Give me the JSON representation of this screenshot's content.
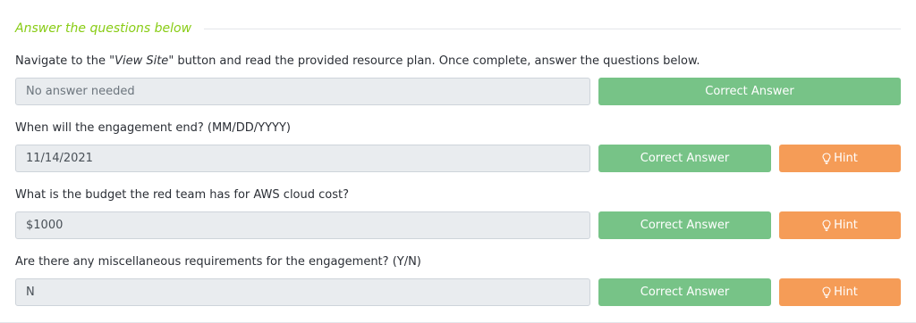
{
  "section": {
    "title": "Answer the questions below"
  },
  "questions": [
    {
      "text_before": "Navigate to the \"",
      "text_em": "View Site",
      "text_after": "\" button and read the provided resource plan. Once complete, answer the questions below.",
      "answer_value": "",
      "answer_placeholder": "No answer needed",
      "button_label": "Correct Answer"
    },
    {
      "text": "When will the engagement end? (MM/DD/YYYY)",
      "answer_value": "11/14/2021",
      "button_label": "Correct Answer",
      "hint_label": "Hint",
      "hint_icon": "lightbulb-icon"
    },
    {
      "text": "What is the budget the red team has for AWS cloud cost?",
      "answer_value": "$1000",
      "button_label": "Correct Answer",
      "hint_label": "Hint",
      "hint_icon": "lightbulb-icon"
    },
    {
      "text": "Are there any miscellaneous requirements for the engagement? (Y/N)",
      "answer_value": "N",
      "button_label": "Correct Answer",
      "hint_label": "Hint",
      "hint_icon": "lightbulb-icon"
    }
  ],
  "colors": {
    "title_accent": "#88cc14",
    "correct_button": "#77c387",
    "hint_button": "#f59c57",
    "input_background": "#e9ecef"
  }
}
